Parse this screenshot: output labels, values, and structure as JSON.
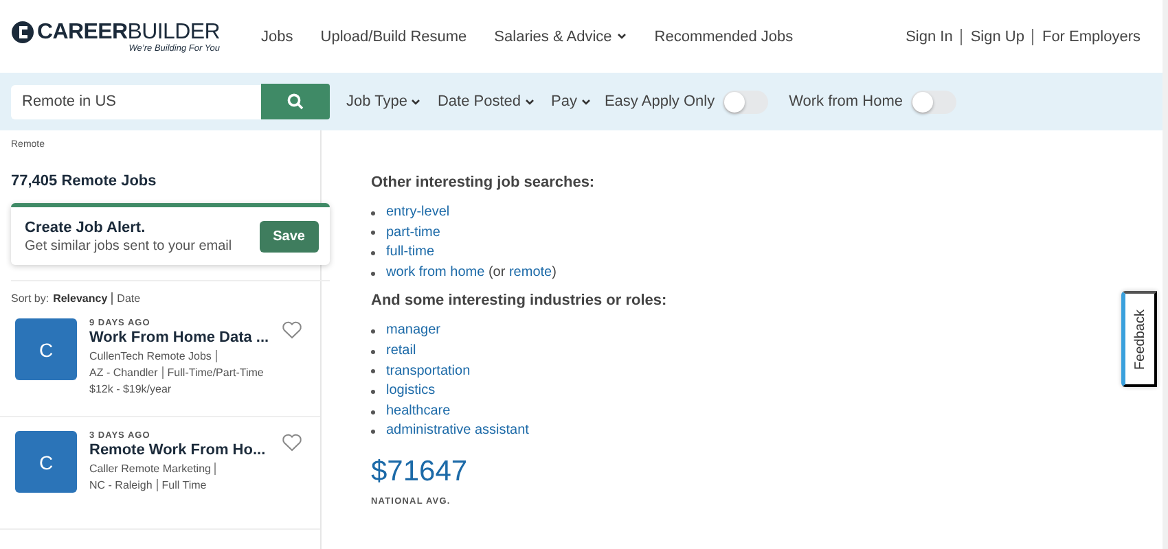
{
  "header": {
    "logo": {
      "wordmark": "**CAREER**BUILDER",
      "tagline": "We’re Building For You"
    },
    "nav": [
      {
        "label": "Jobs",
        "dropdown": false
      },
      {
        "label": "Upload/Build Resume",
        "dropdown": false
      },
      {
        "label": "Salaries & Advice",
        "dropdown": true
      },
      {
        "label": "Recommended Jobs",
        "dropdown": false
      }
    ],
    "account_links": [
      "Sign In",
      "Sign Up",
      "For Employers"
    ]
  },
  "search_bar": {
    "query": "Remote in US",
    "filters": [
      {
        "label": "Job Type"
      },
      {
        "label": "Date Posted"
      },
      {
        "label": "Pay"
      }
    ],
    "toggles": [
      {
        "label": "Easy Apply Only",
        "on": false
      },
      {
        "label": "Work from Home",
        "on": false
      }
    ]
  },
  "breadcrumb": "Remote",
  "results_count": "77,405 Remote Jobs",
  "job_alert": {
    "title": "Create Job Alert.",
    "subtitle": "Get similar jobs sent to your email",
    "button": "Save"
  },
  "sort": {
    "label": "Sort by:",
    "options": [
      {
        "label": "Relevancy",
        "selected": true
      },
      {
        "label": "Date",
        "selected": false
      }
    ]
  },
  "jobs": [
    {
      "logo_letter": "C",
      "posted": "9 DAYS AGO",
      "title": "Work From Home Data ...",
      "company": "CullenTech Remote Jobs",
      "location": "AZ - Chandler",
      "type": "Full-Time/Part-Time",
      "salary": "$12k - $19k/year",
      "saved": false
    },
    {
      "logo_letter": "C",
      "posted": "3 DAYS AGO",
      "title": "Remote Work From Ho...",
      "company": "Caller Remote Marketing",
      "location": "NC - Raleigh",
      "type": "Full Time",
      "saved": false
    }
  ],
  "related_searches": {
    "title": "Other interesting job searches:",
    "items": [
      {
        "label": "entry-level"
      },
      {
        "label": "part-time"
      },
      {
        "label": "full-time"
      },
      {
        "label": "work from home",
        "alt_prefix": "(or ",
        "alt_link": "remote",
        "alt_suffix": ")"
      }
    ]
  },
  "related_roles": {
    "title": "And some interesting industries or roles:",
    "items": [
      {
        "label": "manager"
      },
      {
        "label": "retail"
      },
      {
        "label": "transportation"
      },
      {
        "label": "logistics"
      },
      {
        "label": "healthcare"
      },
      {
        "label": "administrative assistant"
      }
    ]
  },
  "salary": {
    "amount": "$71647",
    "caption": "NATIONAL AVG."
  },
  "feedback_tab": "Feedback"
}
